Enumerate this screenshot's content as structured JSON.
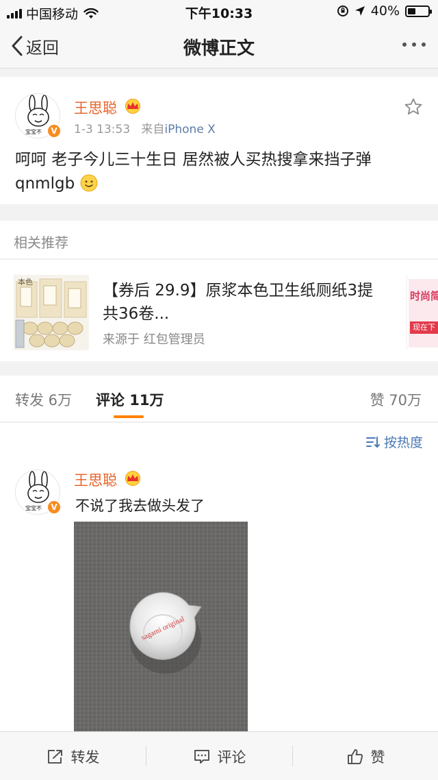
{
  "status_bar": {
    "carrier": "中国移动",
    "time": "下午10:33",
    "battery": "40%",
    "battery_level": 0.4
  },
  "nav": {
    "back_label": "返回",
    "title": "微博正文"
  },
  "post": {
    "author": "王思聪",
    "timestamp": "1-3 13:53",
    "source_prefix": "来自",
    "source": "iPhone X",
    "text_line1": "呵呵 老子今儿三十生日 居然被人买热搜拿来挡子弹",
    "text_line2": "qnmlgb",
    "avatar_caption": "宝宝不",
    "verified_mark": "V"
  },
  "related": {
    "heading": "相关推荐",
    "item_title": "【券后 29.9】原浆本色卫生纸厕纸3提 共36卷...",
    "item_source": "来源于 红包管理员",
    "thumb_text": "本色",
    "next_thumb_text": "时尚简",
    "next_thumb_badge": "现在下"
  },
  "tabs": {
    "repost": "转发 6万",
    "comment": "评论 11万",
    "like": "赞 70万"
  },
  "sort": {
    "label": "按热度"
  },
  "comment": {
    "author": "王思聪",
    "text": "不说了我去做头发了",
    "image_text": "sagami original"
  },
  "bottom_bar": {
    "repost": "转发",
    "comment": "评论",
    "like": "赞"
  },
  "colors": {
    "username": "#e8642b",
    "accent": "#ff8200",
    "link": "#4a78b3"
  }
}
